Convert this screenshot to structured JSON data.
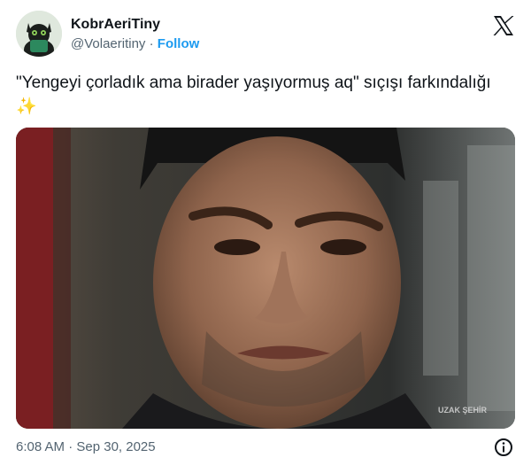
{
  "tweet": {
    "author": {
      "display_name": "KobrAeriTiny",
      "handle": "@Volaeritiny",
      "separator": "·",
      "follow_label": "Follow",
      "avatar_icon": "black-cat-avatar"
    },
    "platform_icon": "x-logo-icon",
    "text": "\"Yengeyi çorladık ama birader yaşıyormuş aq\" sıçışı farkındalığı ✨",
    "media": {
      "description_icon": "video-still-man-frowning",
      "watermark": "UZAK ŞEHİR"
    },
    "timestamp": "6:08 AM · Sep 30, 2025",
    "info_icon": "info-icon"
  },
  "colors": {
    "text_primary": "#0f1419",
    "text_secondary": "#536471",
    "accent": "#1d9bf0"
  }
}
